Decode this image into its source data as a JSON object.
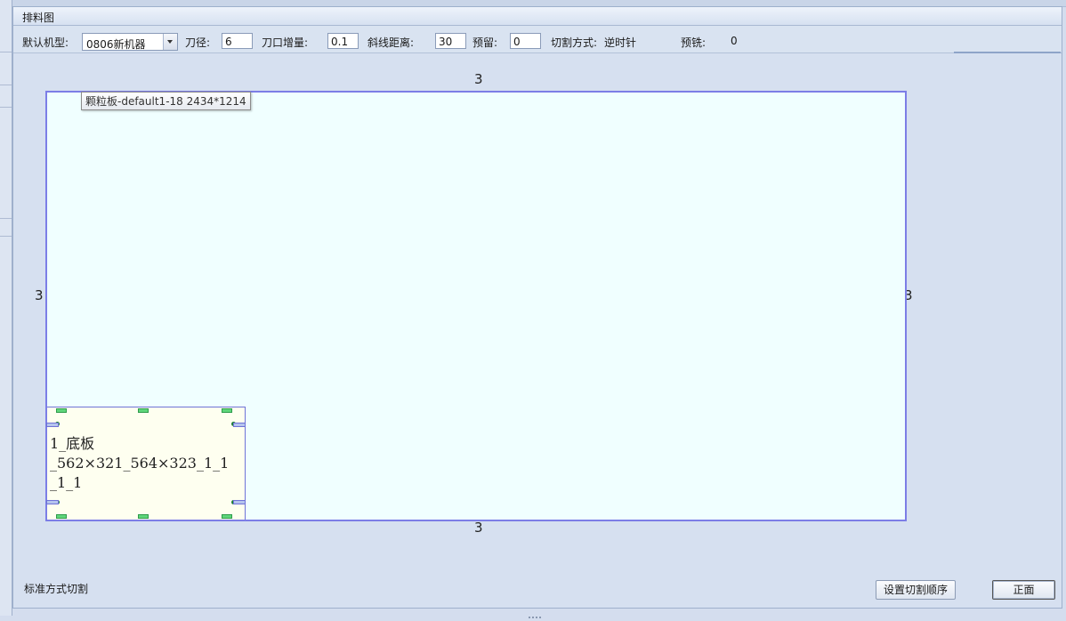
{
  "panel": {
    "title": "排料图"
  },
  "toolbar": {
    "machine_label": "默认机型:",
    "machine_value": "0806新机器",
    "blade_label": "刀径:",
    "blade_value": "6",
    "kerf_label": "刀口增量:",
    "kerf_value": "0.1",
    "bevel_label": "斜线距离:",
    "bevel_value": "30",
    "reserve_label": "预留:",
    "reserve_value": "0",
    "cut_mode_label": "切割方式:",
    "cut_mode_value": "逆时针",
    "premill_label": "预铣:",
    "premill_value": "0"
  },
  "canvas": {
    "margin_top": "3",
    "margin_bottom": "3",
    "margin_left": "3",
    "margin_right": "3",
    "sheet_tooltip": "颗粒板-default1-18 2434*1214",
    "part": {
      "line1": "1_底板",
      "line2": "_562×321_564×323_1_1",
      "line3": "_1_1"
    }
  },
  "footer": {
    "status": "标准方式切割",
    "set_order_button": "设置切割顺序",
    "front_button": "正面"
  }
}
